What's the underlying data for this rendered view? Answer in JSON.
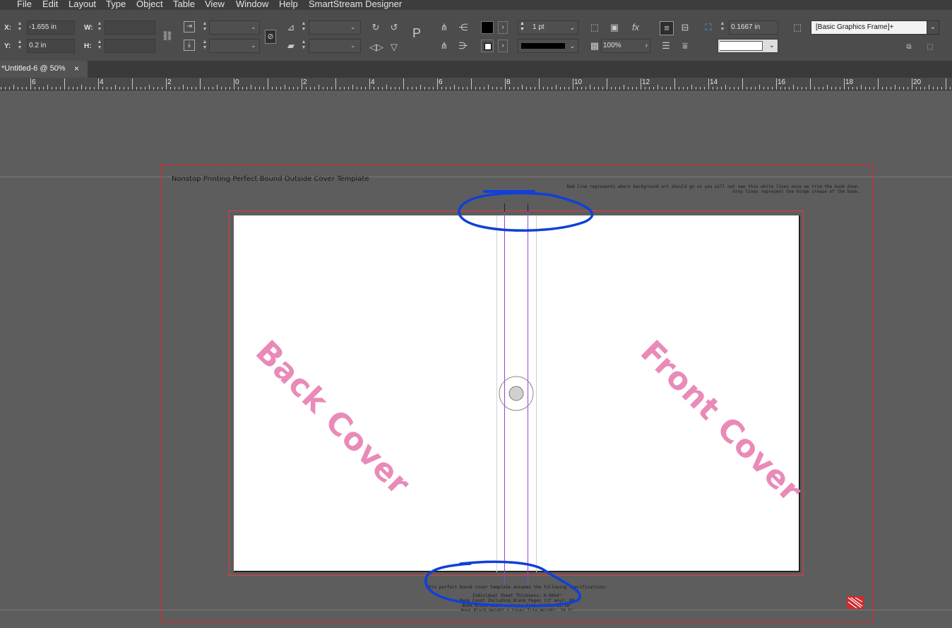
{
  "menu": [
    "File",
    "Edit",
    "Layout",
    "Type",
    "Object",
    "Table",
    "View",
    "Window",
    "Help",
    "SmartStream Designer"
  ],
  "control": {
    "x_label": "X:",
    "x_value": "-1.655 in",
    "y_label": "Y:",
    "y_value": "0.2 in",
    "w_label": "W:",
    "h_label": "H:",
    "stroke_weight": "1 pt",
    "opacity": "100%",
    "fitting_value": "0.1667 in",
    "object_style": "[Basic Graphics Frame]+",
    "fill_color": "#000000",
    "stroke_color": "#000000"
  },
  "tab": {
    "title": "*Untitled-6 @ 50%",
    "close": "×"
  },
  "ruler": [
    "6",
    "4",
    "2",
    "0",
    "2",
    "4",
    "6",
    "8",
    "10",
    "12",
    "14",
    "16",
    "18",
    "20"
  ],
  "document": {
    "title": "Nonstop Printing Perfect Bound Outside Cover Template",
    "note_line1": "Red line represents where background art should go so you will not see thin white lines once we trim the book down.",
    "note_line2": "Grey lines represent the hinge crease of the book.",
    "back_cover": "Back Cover",
    "front_cover": "Front Cover",
    "spec_line1": "This perfect bound cover template assumes the following specifications:",
    "spec_line2": "Individual Sheet Thickness: 0.0064\"",
    "spec_line3": "Page Count Including Blank Pages (if any): 80",
    "spec_line4": "Book Block Width + Cover Trim Width: 16.18\"",
    "spec_line5": "Book Block Height + Cover Trim Height: 10.5\""
  },
  "colors": {
    "annotation": "#1040d8",
    "bleed": "#e0242a",
    "cover_text": "#e98ab8",
    "spine_guide": "#9a3fd8"
  }
}
